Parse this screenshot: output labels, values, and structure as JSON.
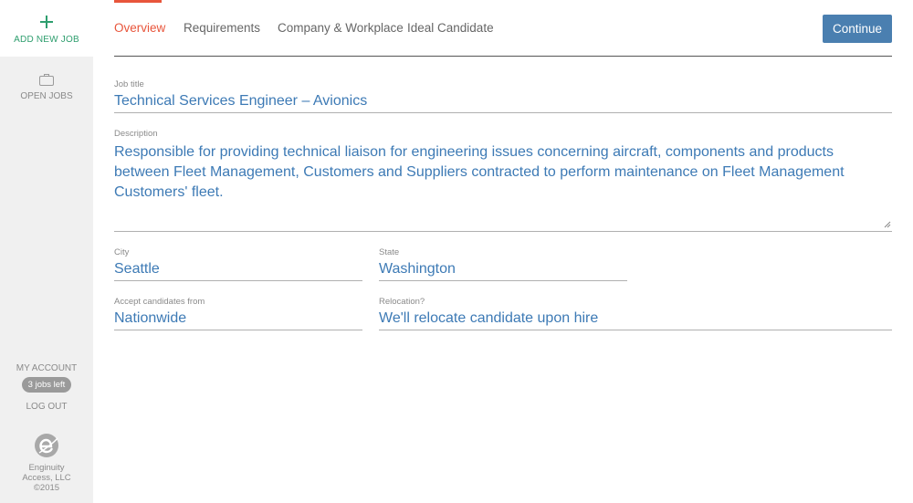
{
  "sidebar": {
    "add_new_job": "ADD NEW JOB",
    "open_jobs": "OPEN JOBS",
    "my_account": "MY ACCOUNT",
    "jobs_left": "3 jobs left",
    "log_out": "LOG OUT",
    "footer_line1": "Enginuity",
    "footer_line2": "Access, LLC",
    "footer_line3": "©2015"
  },
  "tabs": [
    {
      "label": "Overview",
      "active": true
    },
    {
      "label": "Requirements",
      "active": false
    },
    {
      "label": "Company & Workplace",
      "active": false
    },
    {
      "label": "Ideal Candidate",
      "active": false
    }
  ],
  "continue_label": "Continue",
  "form": {
    "job_title_label": "Job title",
    "job_title_value": "Technical Services Engineer – Avionics",
    "description_label": "Description",
    "description_value": "Responsible for providing technical liaison for engineering issues concerning aircraft, components and products between Fleet Management, Customers and Suppliers contracted to perform maintenance on Fleet Management Customers' fleet.",
    "city_label": "City",
    "city_value": "Seattle",
    "state_label": "State",
    "state_value": "Washington",
    "accept_label": "Accept candidates from",
    "accept_value": "Nationwide",
    "relocation_label": "Relocation?",
    "relocation_value": "We'll relocate candidate upon hire"
  },
  "colors": {
    "accent_active_tab": "#e8553b",
    "add_job_green": "#2e9e6e",
    "input_text_blue": "#3d7ab5",
    "continue_button": "#4a7fb0"
  }
}
